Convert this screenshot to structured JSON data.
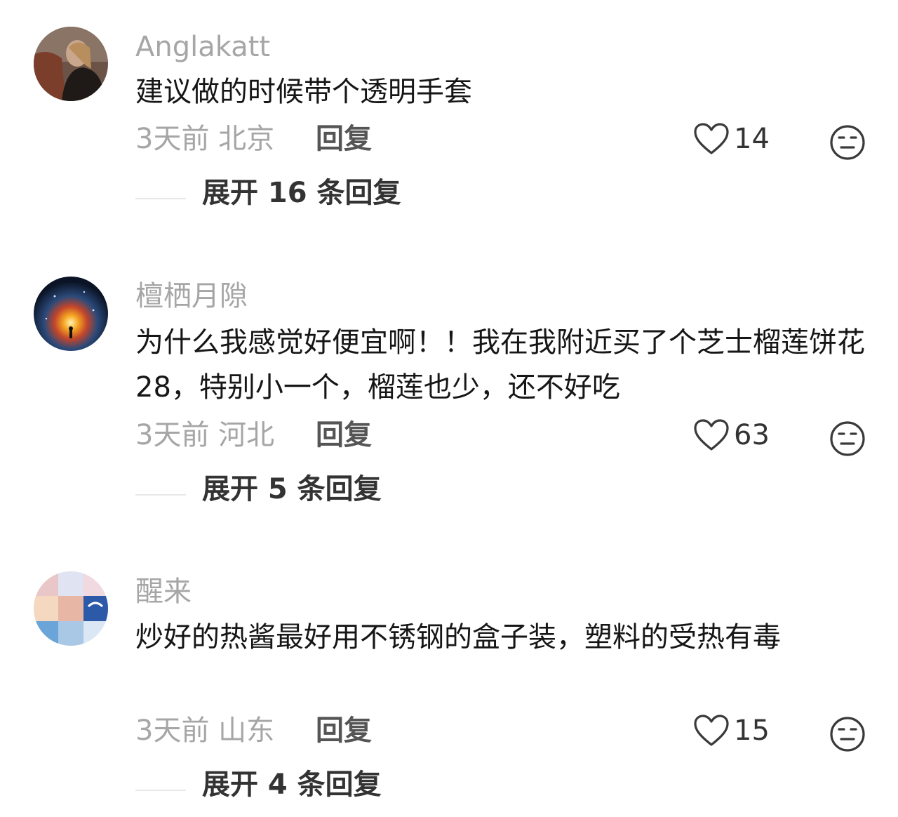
{
  "comments": [
    {
      "username": "Anglakatt",
      "content": "建议做的时候带个透明手套",
      "time_location": "3天前 北京",
      "reply_label": "回复",
      "likes": "14",
      "expand_label": "展开 16 条回复",
      "like_icon": "heart-outline-icon",
      "dislike_icon": "neutral-face-icon"
    },
    {
      "username": "檀栖月隙",
      "content": "为什么我感觉好便宜啊！！我在我附近买了个芝士榴莲饼花28，特别小一个，榴莲也少，还不好吃",
      "time_location": "3天前 河北",
      "reply_label": "回复",
      "likes": "63",
      "expand_label": "展开 5 条回复",
      "like_icon": "heart-outline-icon",
      "dislike_icon": "neutral-face-icon"
    },
    {
      "username": "醒来",
      "content": "炒好的热酱最好用不锈钢的盒子装，塑料的受热有毒",
      "time_location": "3天前 山东",
      "reply_label": "回复",
      "likes": "15",
      "expand_label": "展开 4 条回复",
      "like_icon": "heart-outline-icon",
      "dislike_icon": "neutral-face-icon"
    }
  ]
}
